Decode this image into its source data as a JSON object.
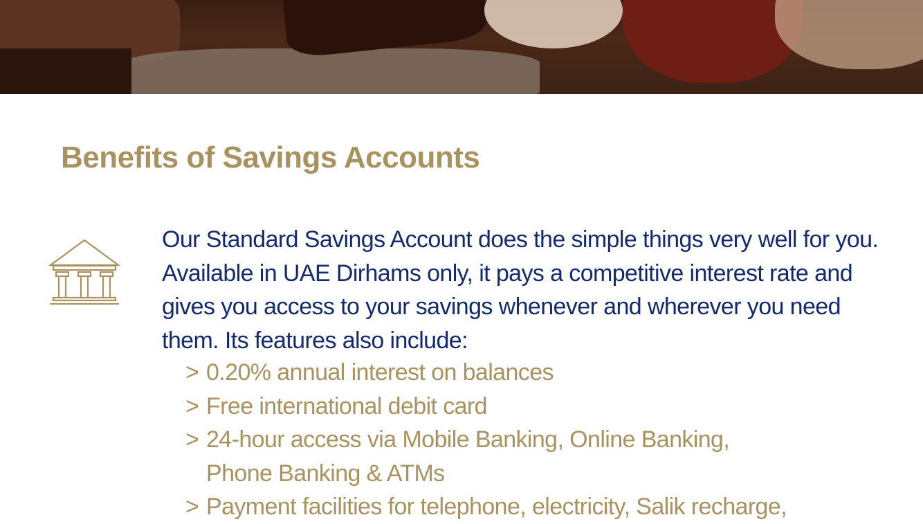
{
  "heading": "Benefits of Savings Accounts",
  "intro": "Our Standard Savings Account does the simple things very well for you. Available in UAE Dirhams only, it pays a competitive interest rate and gives you access to your savings whenever and wherever you need them. Its features also include:",
  "features": [
    {
      "marker": ">",
      "text": "0.20% annual interest on balances"
    },
    {
      "marker": ">",
      "text": "Free international debit card"
    },
    {
      "marker": ">",
      "text": "24-hour access via Mobile Banking, Online Banking,\nPhone Banking & ATMs"
    },
    {
      "marker": ">",
      "text": "Payment facilities for telephone, electricity, Salik recharge,"
    }
  ],
  "icons": {
    "bank": "bank-building-icon"
  },
  "colors": {
    "gold": "#a8925f",
    "navy": "#142a6e",
    "background": "#ffffff"
  }
}
